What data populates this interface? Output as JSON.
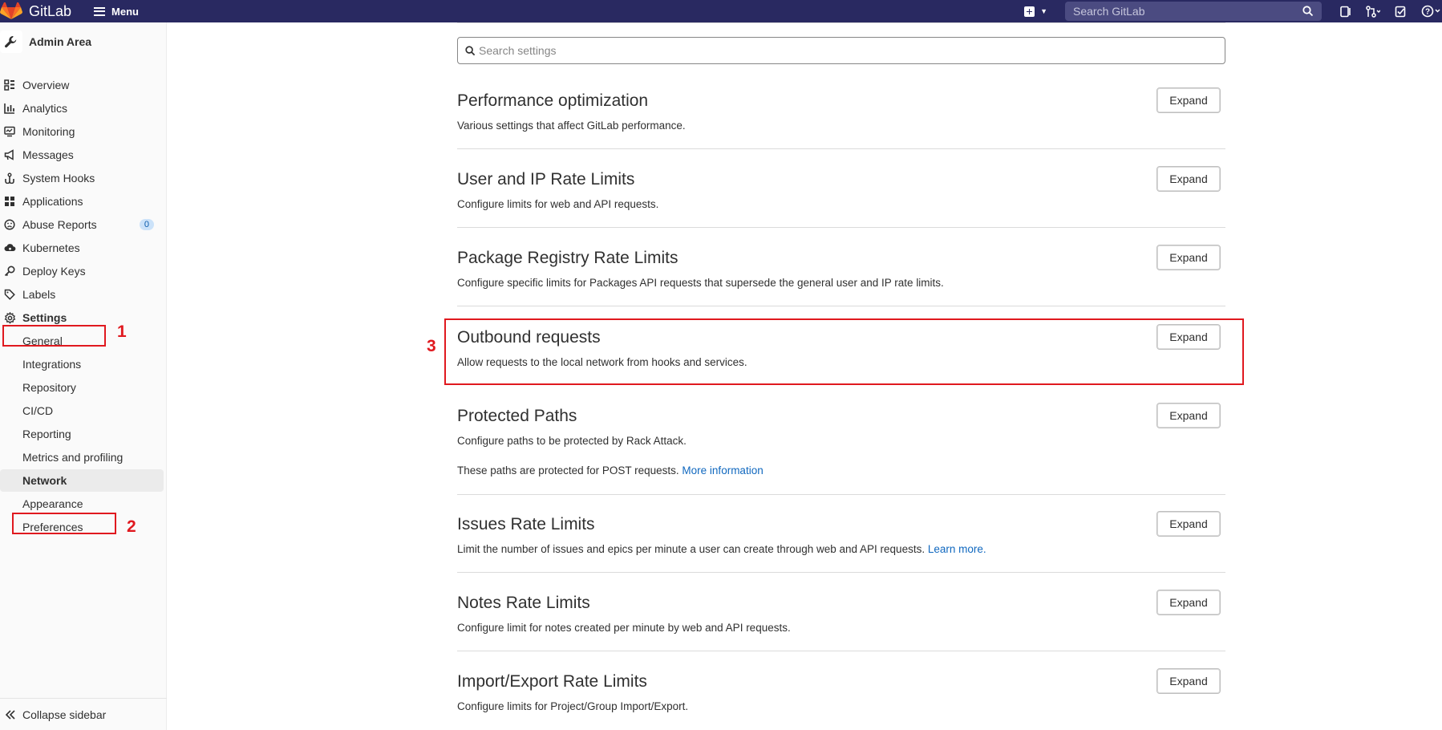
{
  "topbar": {
    "brand": "GitLab",
    "menu_label": "Menu",
    "search_placeholder": "Search GitLab",
    "icons": [
      "plus-square-icon",
      "chevron-down-icon",
      "search-icon",
      "issues-icon",
      "merge-request-icon",
      "todo-icon",
      "help-icon"
    ]
  },
  "sidebar": {
    "context_title": "Admin Area",
    "items": [
      {
        "label": "Overview",
        "icon": "overview-icon"
      },
      {
        "label": "Analytics",
        "icon": "chart-icon"
      },
      {
        "label": "Monitoring",
        "icon": "monitor-icon"
      },
      {
        "label": "Messages",
        "icon": "bullhorn-icon"
      },
      {
        "label": "System Hooks",
        "icon": "hook-icon"
      },
      {
        "label": "Applications",
        "icon": "applications-icon"
      },
      {
        "label": "Abuse Reports",
        "icon": "slight-frown-icon",
        "badge": "0"
      },
      {
        "label": "Kubernetes",
        "icon": "cloud-gear-icon"
      },
      {
        "label": "Deploy Keys",
        "icon": "key-icon"
      },
      {
        "label": "Labels",
        "icon": "label-icon"
      },
      {
        "label": "Settings",
        "icon": "settings-icon",
        "active": true
      }
    ],
    "settings_sub": [
      {
        "label": "General"
      },
      {
        "label": "Integrations"
      },
      {
        "label": "Repository"
      },
      {
        "label": "CI/CD"
      },
      {
        "label": "Reporting"
      },
      {
        "label": "Metrics and profiling"
      },
      {
        "label": "Network",
        "active": true
      },
      {
        "label": "Appearance"
      },
      {
        "label": "Preferences"
      }
    ],
    "collapse_label": "Collapse sidebar"
  },
  "annotations": {
    "one": "1",
    "two": "2",
    "three": "3",
    "color": "#e0191f"
  },
  "main": {
    "search_placeholder": "Search settings",
    "expand_label": "Expand",
    "sections": [
      {
        "title": "Performance optimization",
        "desc": "Various settings that affect GitLab performance."
      },
      {
        "title": "User and IP Rate Limits",
        "desc": "Configure limits for web and API requests."
      },
      {
        "title": "Package Registry Rate Limits",
        "desc": "Configure specific limits for Packages API requests that supersede the general user and IP rate limits."
      },
      {
        "title": "Outbound requests",
        "desc": "Allow requests to the local network from hooks and services."
      },
      {
        "title": "Protected Paths",
        "desc": "Configure paths to be protected by Rack Attack.",
        "extra": "These paths are protected for POST requests.",
        "extra_link": "More information"
      },
      {
        "title": "Issues Rate Limits",
        "desc": "Limit the number of issues and epics per minute a user can create through web and API requests.",
        "desc_link": "Learn more."
      },
      {
        "title": "Notes Rate Limits",
        "desc": "Configure limit for notes created per minute by web and API requests."
      },
      {
        "title": "Import/Export Rate Limits",
        "desc": "Configure limits for Project/Group Import/Export."
      }
    ]
  },
  "colors": {
    "topbar_bg": "#292961",
    "link": "#1068bf",
    "annotation": "#e0191f"
  }
}
